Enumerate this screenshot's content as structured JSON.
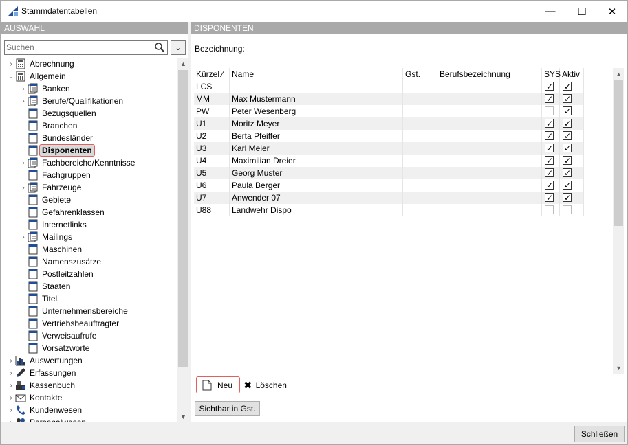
{
  "window": {
    "title": "Stammdatentabellen",
    "minimize": "—",
    "maximize": "☐",
    "close": "✕"
  },
  "left": {
    "header": "AUSWAHL",
    "search": {
      "placeholder": "Suchen"
    },
    "tree": [
      {
        "label": "Abrechnung",
        "level": 0,
        "expand": "›",
        "icon": "calculator-icon"
      },
      {
        "label": "Allgemein",
        "level": 0,
        "expand": "⌄",
        "icon": "calculator-icon"
      },
      {
        "label": "Banken",
        "level": 1,
        "expand": "›",
        "icon": "table-stack-icon"
      },
      {
        "label": "Berufe/Qualifikationen",
        "level": 1,
        "expand": "›",
        "icon": "table-stack-icon"
      },
      {
        "label": "Bezugsquellen",
        "level": 1,
        "expand": "",
        "icon": "table-icon"
      },
      {
        "label": "Branchen",
        "level": 1,
        "expand": "",
        "icon": "table-icon"
      },
      {
        "label": "Bundesländer",
        "level": 1,
        "expand": "",
        "icon": "table-icon"
      },
      {
        "label": "Disponenten",
        "level": 1,
        "expand": "",
        "icon": "table-icon",
        "selected": true
      },
      {
        "label": "Fachbereiche/Kenntnisse",
        "level": 1,
        "expand": "›",
        "icon": "table-stack-icon"
      },
      {
        "label": "Fachgruppen",
        "level": 1,
        "expand": "",
        "icon": "table-icon"
      },
      {
        "label": "Fahrzeuge",
        "level": 1,
        "expand": "›",
        "icon": "table-stack-icon"
      },
      {
        "label": "Gebiete",
        "level": 1,
        "expand": "",
        "icon": "table-icon"
      },
      {
        "label": "Gefahrenklassen",
        "level": 1,
        "expand": "",
        "icon": "table-icon"
      },
      {
        "label": "Internetlinks",
        "level": 1,
        "expand": "",
        "icon": "table-icon"
      },
      {
        "label": "Mailings",
        "level": 1,
        "expand": "›",
        "icon": "table-stack-icon"
      },
      {
        "label": "Maschinen",
        "level": 1,
        "expand": "",
        "icon": "table-icon"
      },
      {
        "label": "Namenszusätze",
        "level": 1,
        "expand": "",
        "icon": "table-icon"
      },
      {
        "label": "Postleitzahlen",
        "level": 1,
        "expand": "",
        "icon": "table-icon"
      },
      {
        "label": "Staaten",
        "level": 1,
        "expand": "",
        "icon": "table-icon"
      },
      {
        "label": "Titel",
        "level": 1,
        "expand": "",
        "icon": "table-icon"
      },
      {
        "label": "Unternehmensbereiche",
        "level": 1,
        "expand": "",
        "icon": "table-icon"
      },
      {
        "label": "Vertriebsbeauftragter",
        "level": 1,
        "expand": "",
        "icon": "table-icon"
      },
      {
        "label": "Verweisaufrufe",
        "level": 1,
        "expand": "",
        "icon": "table-icon"
      },
      {
        "label": "Vorsatzworte",
        "level": 1,
        "expand": "",
        "icon": "table-icon"
      },
      {
        "label": "Auswertungen",
        "level": 0,
        "expand": "›",
        "icon": "bar-chart-icon"
      },
      {
        "label": "Erfassungen",
        "level": 0,
        "expand": "›",
        "icon": "pencil-icon"
      },
      {
        "label": "Kassenbuch",
        "level": 0,
        "expand": "›",
        "icon": "cash-register-icon"
      },
      {
        "label": "Kontakte",
        "level": 0,
        "expand": "›",
        "icon": "envelope-icon"
      },
      {
        "label": "Kundenwesen",
        "level": 0,
        "expand": "›",
        "icon": "phone-icon"
      },
      {
        "label": "Personalwesen",
        "level": 0,
        "expand": "›",
        "icon": "people-icon"
      }
    ]
  },
  "right": {
    "header": "DISPONENTEN",
    "bezeichnung_label": "Bezeichnung:",
    "bezeichnung_value": "",
    "columns": [
      "Kürzel ⁄",
      "Name",
      "Gst.",
      "Berufsbezeichnung",
      "SYS",
      "Aktiv"
    ],
    "rows": [
      {
        "kuerzel": "LCS",
        "name": "",
        "gst": "",
        "beruf": "",
        "sys": true,
        "aktiv": true
      },
      {
        "kuerzel": "MM",
        "name": "Max Mustermann",
        "gst": "",
        "beruf": "",
        "sys": true,
        "aktiv": true
      },
      {
        "kuerzel": "PW",
        "name": "Peter Wesenberg",
        "gst": "",
        "beruf": "",
        "sys": false,
        "aktiv": true
      },
      {
        "kuerzel": "U1",
        "name": "Moritz Meyer",
        "gst": "",
        "beruf": "",
        "sys": true,
        "aktiv": true
      },
      {
        "kuerzel": "U2",
        "name": "Berta Pfeiffer",
        "gst": "",
        "beruf": "",
        "sys": true,
        "aktiv": true
      },
      {
        "kuerzel": "U3",
        "name": "Karl Meier",
        "gst": "",
        "beruf": "",
        "sys": true,
        "aktiv": true
      },
      {
        "kuerzel": "U4",
        "name": "Maximilian Dreier",
        "gst": "",
        "beruf": "",
        "sys": true,
        "aktiv": true
      },
      {
        "kuerzel": "U5",
        "name": "Georg Muster",
        "gst": "",
        "beruf": "",
        "sys": true,
        "aktiv": true
      },
      {
        "kuerzel": "U6",
        "name": "Paula Berger",
        "gst": "",
        "beruf": "",
        "sys": true,
        "aktiv": true
      },
      {
        "kuerzel": "U7",
        "name": "Anwender 07",
        "gst": "",
        "beruf": "",
        "sys": true,
        "aktiv": true
      },
      {
        "kuerzel": "U88",
        "name": "Landwehr Dispo",
        "gst": "",
        "beruf": "",
        "sys": false,
        "aktiv": false
      }
    ],
    "btn_neu": "Neu",
    "btn_loeschen": "Löschen",
    "btn_sichtbar": "Sichtbar in Gst."
  },
  "footer": {
    "btn_schliessen": "Schließen"
  }
}
